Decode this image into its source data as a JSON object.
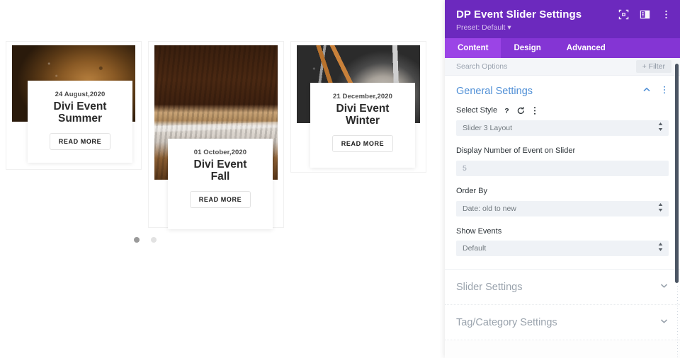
{
  "preview": {
    "slides": [
      {
        "image": "coffee-grounds-photo",
        "date": "24 August,2020",
        "title": "Divi Event\nSummer",
        "title_line1": "Divi Event",
        "title_line2": "Summer",
        "button": "READ MORE"
      },
      {
        "image": "wooden-table-photo",
        "date": "01 October,2020",
        "title": "Divi Event\nFall",
        "title_line1": "Divi Event",
        "title_line2": "Fall",
        "button": "READ MORE"
      },
      {
        "image": "hand-tools-photo",
        "date": "21 December,2020",
        "title": "Divi Event\nWinter",
        "title_line1": "Divi Event",
        "title_line2": "Winter",
        "button": "READ MORE"
      }
    ],
    "pagination": {
      "count": 2,
      "active_index": 0
    }
  },
  "panel": {
    "title": "DP Event Slider Settings",
    "preset": "Preset: Default",
    "header_icons": [
      "focus-mode-icon",
      "panel-layout-icon",
      "more-options-icon"
    ],
    "tabs": [
      {
        "label": "Content",
        "active": true
      },
      {
        "label": "Design",
        "active": false
      },
      {
        "label": "Advanced",
        "active": false
      }
    ],
    "search": {
      "placeholder": "Search Options",
      "value": ""
    },
    "filter_button": "+ Filter",
    "sections": [
      {
        "title": "General Settings",
        "state": "open",
        "collapse_icon": "chevron-up-icon",
        "menu_icon": "more-options-icon",
        "fields": [
          {
            "label": "Select Style",
            "icons": [
              "help-icon",
              "reset-icon",
              "more-options-icon"
            ],
            "type": "select",
            "value": "Slider 3 Layout"
          },
          {
            "label": "Display Number of Event on Slider",
            "icons": [],
            "type": "text",
            "value": "5"
          },
          {
            "label": "Order By",
            "icons": [],
            "type": "select",
            "value": "Date: old to new"
          },
          {
            "label": "Show Events",
            "icons": [],
            "type": "select",
            "value": "Default"
          }
        ]
      },
      {
        "title": "Slider Settings",
        "state": "closed",
        "collapse_icon": "chevron-down-icon"
      },
      {
        "title": "Tag/Category Settings",
        "state": "closed",
        "collapse_icon": "chevron-down-icon"
      }
    ]
  },
  "colors": {
    "header_purple": "#6C29BE",
    "tabbar_purple": "#8435D4",
    "tab_active_purple": "#9B44E6",
    "section_title_blue": "#4F8FD6",
    "section_title_muted": "#9AA3AD",
    "control_bg": "#EFF2F6",
    "scrollbar": "#4B5563"
  }
}
